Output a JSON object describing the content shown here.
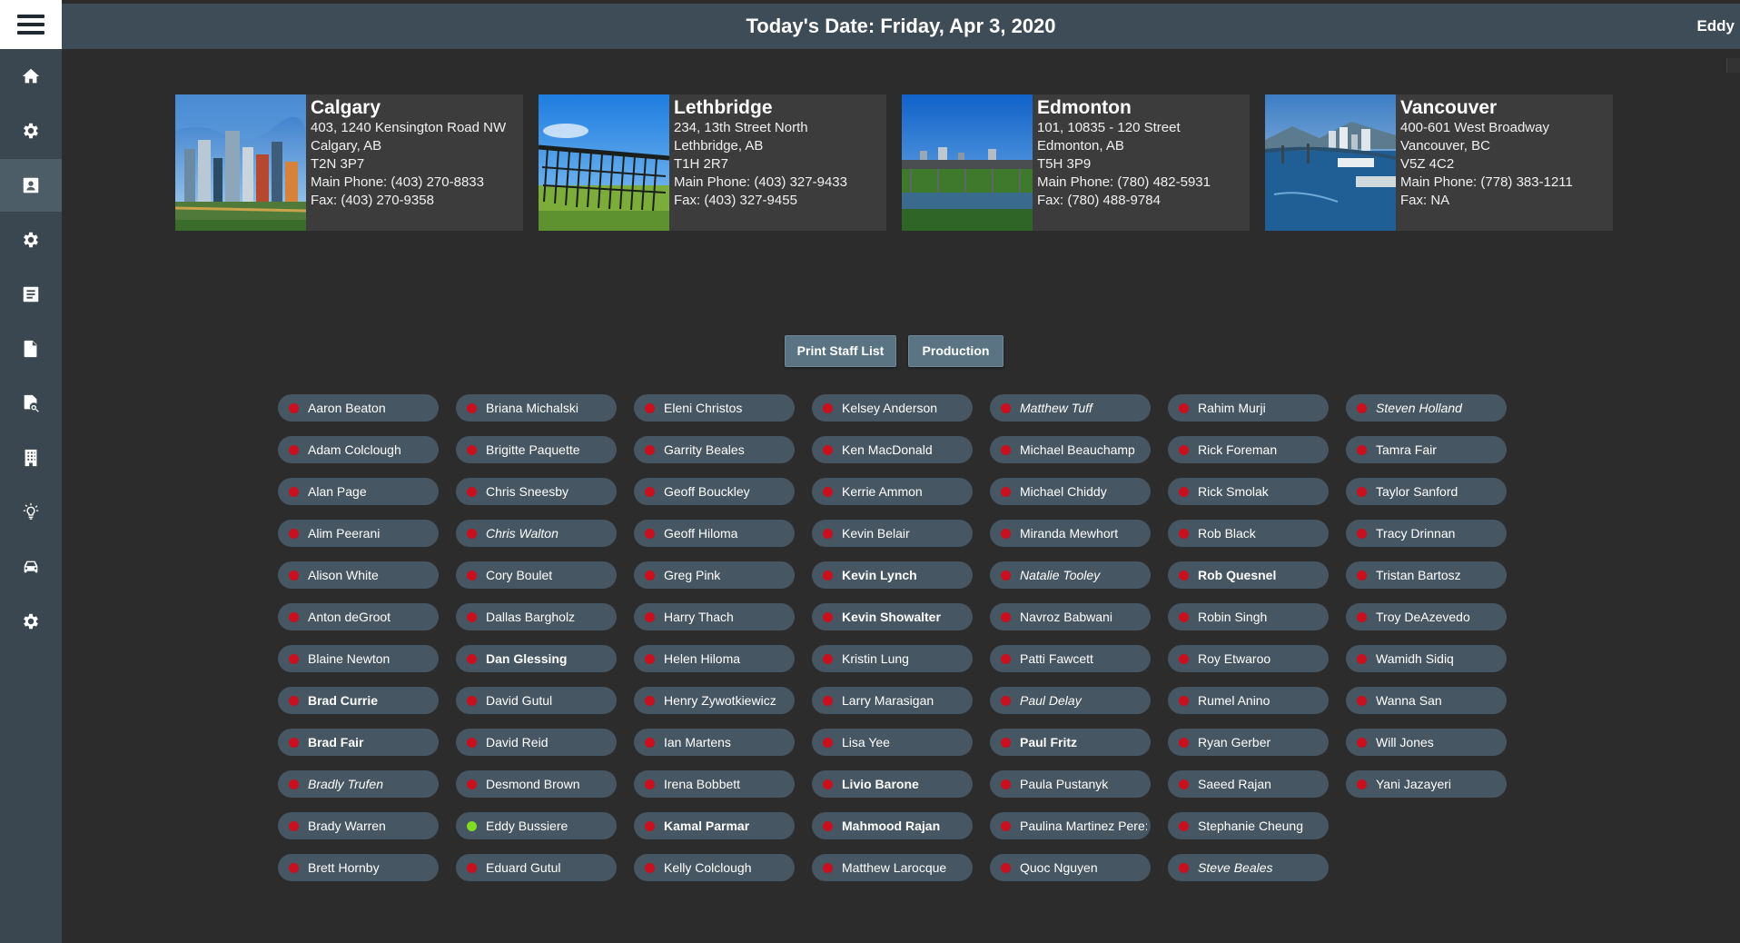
{
  "header": {
    "title": "Today's Date: Friday, Apr 3, 2020",
    "user": "Eddy"
  },
  "sidebar": {
    "items": [
      {
        "icon": "home-icon",
        "active": false
      },
      {
        "icon": "gear-icon",
        "active": false
      },
      {
        "icon": "contact-card-icon",
        "active": true
      },
      {
        "icon": "gear-icon",
        "active": false
      },
      {
        "icon": "list-document-icon",
        "active": false
      },
      {
        "icon": "file-icon",
        "active": false
      },
      {
        "icon": "file-search-icon",
        "active": false
      },
      {
        "icon": "building-icon",
        "active": false
      },
      {
        "icon": "lightbulb-icon",
        "active": false
      },
      {
        "icon": "car-icon",
        "active": false
      },
      {
        "icon": "gear-icon",
        "active": false
      }
    ]
  },
  "offices": [
    {
      "city": "Calgary",
      "address": "403, 1240 Kensington Road NW",
      "region": "Calgary, AB",
      "postal": "T2N 3P7",
      "phone": "Main Phone: (403) 270-8833",
      "fax": "Fax: (403) 270-9358",
      "photo": "calgary-skyline"
    },
    {
      "city": "Lethbridge",
      "address": "234, 13th Street North",
      "region": "Lethbridge, AB",
      "postal": "T1H 2R7",
      "phone": "Main Phone: (403) 327-9433",
      "fax": "Fax: (403) 327-9455",
      "photo": "lethbridge-viaduct"
    },
    {
      "city": "Edmonton",
      "address": "101, 10835 - 120 Street",
      "region": "Edmonton, AB",
      "postal": "T5H 3P9",
      "phone": "Main Phone: (780) 482-5931",
      "fax": "Fax: (780) 488-9784",
      "photo": "edmonton-bridge"
    },
    {
      "city": "Vancouver",
      "address": "400-601 West Broadway",
      "region": "Vancouver, BC",
      "postal": "V5Z 4C2",
      "phone": "Main Phone: (778) 383-1211",
      "fax": "Fax: NA",
      "photo": "vancouver-harbour"
    }
  ],
  "actions": {
    "print_label": "Print Staff List",
    "production_label": "Production"
  },
  "colors": {
    "status_offline": "#c8101f",
    "status_online": "#7fdd22",
    "pill": "#465662",
    "button": "#5b7484"
  },
  "staff_columns": [
    [
      {
        "name": "Aaron Beaton",
        "status": "offline",
        "style": "normal"
      },
      {
        "name": "Adam Colclough",
        "status": "offline",
        "style": "normal"
      },
      {
        "name": "Alan Page",
        "status": "offline",
        "style": "normal"
      },
      {
        "name": "Alim Peerani",
        "status": "offline",
        "style": "normal"
      },
      {
        "name": "Alison White",
        "status": "offline",
        "style": "normal"
      },
      {
        "name": "Anton deGroot",
        "status": "offline",
        "style": "normal"
      },
      {
        "name": "Blaine Newton",
        "status": "offline",
        "style": "normal"
      },
      {
        "name": "Brad Currie",
        "status": "offline",
        "style": "bold"
      },
      {
        "name": "Brad Fair",
        "status": "offline",
        "style": "bold"
      },
      {
        "name": "Bradly Trufen",
        "status": "offline",
        "style": "italic"
      },
      {
        "name": "Brady Warren",
        "status": "offline",
        "style": "normal"
      },
      {
        "name": "Brett Hornby",
        "status": "offline",
        "style": "normal"
      }
    ],
    [
      {
        "name": "Briana Michalski",
        "status": "offline",
        "style": "normal"
      },
      {
        "name": "Brigitte Paquette",
        "status": "offline",
        "style": "normal"
      },
      {
        "name": "Chris Sneesby",
        "status": "offline",
        "style": "normal"
      },
      {
        "name": "Chris Walton",
        "status": "offline",
        "style": "italic"
      },
      {
        "name": "Cory Boulet",
        "status": "offline",
        "style": "normal"
      },
      {
        "name": "Dallas Bargholz",
        "status": "offline",
        "style": "normal"
      },
      {
        "name": "Dan Glessing",
        "status": "offline",
        "style": "bold"
      },
      {
        "name": "David Gutul",
        "status": "offline",
        "style": "normal"
      },
      {
        "name": "David Reid",
        "status": "offline",
        "style": "normal"
      },
      {
        "name": "Desmond Brown",
        "status": "offline",
        "style": "normal"
      },
      {
        "name": "Eddy Bussiere",
        "status": "online",
        "style": "normal"
      },
      {
        "name": "Eduard Gutul",
        "status": "offline",
        "style": "normal"
      }
    ],
    [
      {
        "name": "Eleni Christos",
        "status": "offline",
        "style": "normal"
      },
      {
        "name": "Garrity Beales",
        "status": "offline",
        "style": "normal"
      },
      {
        "name": "Geoff Bouckley",
        "status": "offline",
        "style": "normal"
      },
      {
        "name": "Geoff Hiloma",
        "status": "offline",
        "style": "normal"
      },
      {
        "name": "Greg Pink",
        "status": "offline",
        "style": "normal"
      },
      {
        "name": "Harry Thach",
        "status": "offline",
        "style": "normal"
      },
      {
        "name": "Helen Hiloma",
        "status": "offline",
        "style": "normal"
      },
      {
        "name": "Henry Zywotkiewicz",
        "status": "offline",
        "style": "normal"
      },
      {
        "name": "Ian Martens",
        "status": "offline",
        "style": "normal"
      },
      {
        "name": "Irena Bobbett",
        "status": "offline",
        "style": "normal"
      },
      {
        "name": "Kamal Parmar",
        "status": "offline",
        "style": "bold"
      },
      {
        "name": "Kelly Colclough",
        "status": "offline",
        "style": "normal"
      }
    ],
    [
      {
        "name": "Kelsey Anderson",
        "status": "offline",
        "style": "normal"
      },
      {
        "name": "Ken MacDonald",
        "status": "offline",
        "style": "normal"
      },
      {
        "name": "Kerrie Ammon",
        "status": "offline",
        "style": "normal"
      },
      {
        "name": "Kevin Belair",
        "status": "offline",
        "style": "normal"
      },
      {
        "name": "Kevin Lynch",
        "status": "offline",
        "style": "bold"
      },
      {
        "name": "Kevin Showalter",
        "status": "offline",
        "style": "bold"
      },
      {
        "name": "Kristin Lung",
        "status": "offline",
        "style": "normal"
      },
      {
        "name": "Larry Marasigan",
        "status": "offline",
        "style": "normal"
      },
      {
        "name": "Lisa Yee",
        "status": "offline",
        "style": "normal"
      },
      {
        "name": "Livio Barone",
        "status": "offline",
        "style": "bold"
      },
      {
        "name": "Mahmood Rajan",
        "status": "offline",
        "style": "bold"
      },
      {
        "name": "Matthew Larocque",
        "status": "offline",
        "style": "normal"
      }
    ],
    [
      {
        "name": "Matthew Tuff",
        "status": "offline",
        "style": "italic"
      },
      {
        "name": "Michael Beauchamp",
        "status": "offline",
        "style": "normal"
      },
      {
        "name": "Michael Chiddy",
        "status": "offline",
        "style": "normal"
      },
      {
        "name": "Miranda Mewhort",
        "status": "offline",
        "style": "normal"
      },
      {
        "name": "Natalie Tooley",
        "status": "offline",
        "style": "italic"
      },
      {
        "name": "Navroz Babwani",
        "status": "offline",
        "style": "normal"
      },
      {
        "name": "Patti Fawcett",
        "status": "offline",
        "style": "normal"
      },
      {
        "name": "Paul Delay",
        "status": "offline",
        "style": "italic"
      },
      {
        "name": "Paul Fritz",
        "status": "offline",
        "style": "bold"
      },
      {
        "name": "Paula Pustanyk",
        "status": "offline",
        "style": "normal"
      },
      {
        "name": "Paulina Martinez Pere:",
        "status": "offline",
        "style": "normal"
      },
      {
        "name": "Quoc Nguyen",
        "status": "offline",
        "style": "normal"
      }
    ],
    [
      {
        "name": "Rahim Murji",
        "status": "offline",
        "style": "normal"
      },
      {
        "name": "Rick Foreman",
        "status": "offline",
        "style": "normal"
      },
      {
        "name": "Rick Smolak",
        "status": "offline",
        "style": "normal"
      },
      {
        "name": "Rob Black",
        "status": "offline",
        "style": "normal"
      },
      {
        "name": "Rob Quesnel",
        "status": "offline",
        "style": "bold"
      },
      {
        "name": "Robin Singh",
        "status": "offline",
        "style": "normal"
      },
      {
        "name": "Roy Etwaroo",
        "status": "offline",
        "style": "normal"
      },
      {
        "name": "Rumel Anino",
        "status": "offline",
        "style": "normal"
      },
      {
        "name": "Ryan Gerber",
        "status": "offline",
        "style": "normal"
      },
      {
        "name": "Saeed Rajan",
        "status": "offline",
        "style": "normal"
      },
      {
        "name": "Stephanie Cheung",
        "status": "offline",
        "style": "normal"
      },
      {
        "name": "Steve Beales",
        "status": "offline",
        "style": "italic"
      }
    ],
    [
      {
        "name": "Steven Holland",
        "status": "offline",
        "style": "italic"
      },
      {
        "name": "Tamra Fair",
        "status": "offline",
        "style": "normal"
      },
      {
        "name": "Taylor Sanford",
        "status": "offline",
        "style": "normal"
      },
      {
        "name": "Tracy Drinnan",
        "status": "offline",
        "style": "normal"
      },
      {
        "name": "Tristan Bartosz",
        "status": "offline",
        "style": "normal"
      },
      {
        "name": "Troy DeAzevedo",
        "status": "offline",
        "style": "normal"
      },
      {
        "name": "Wamidh Sidiq",
        "status": "offline",
        "style": "normal"
      },
      {
        "name": "Wanna San",
        "status": "offline",
        "style": "normal"
      },
      {
        "name": "Will Jones",
        "status": "offline",
        "style": "normal"
      },
      {
        "name": "Yani Jazayeri",
        "status": "offline",
        "style": "normal"
      }
    ]
  ]
}
